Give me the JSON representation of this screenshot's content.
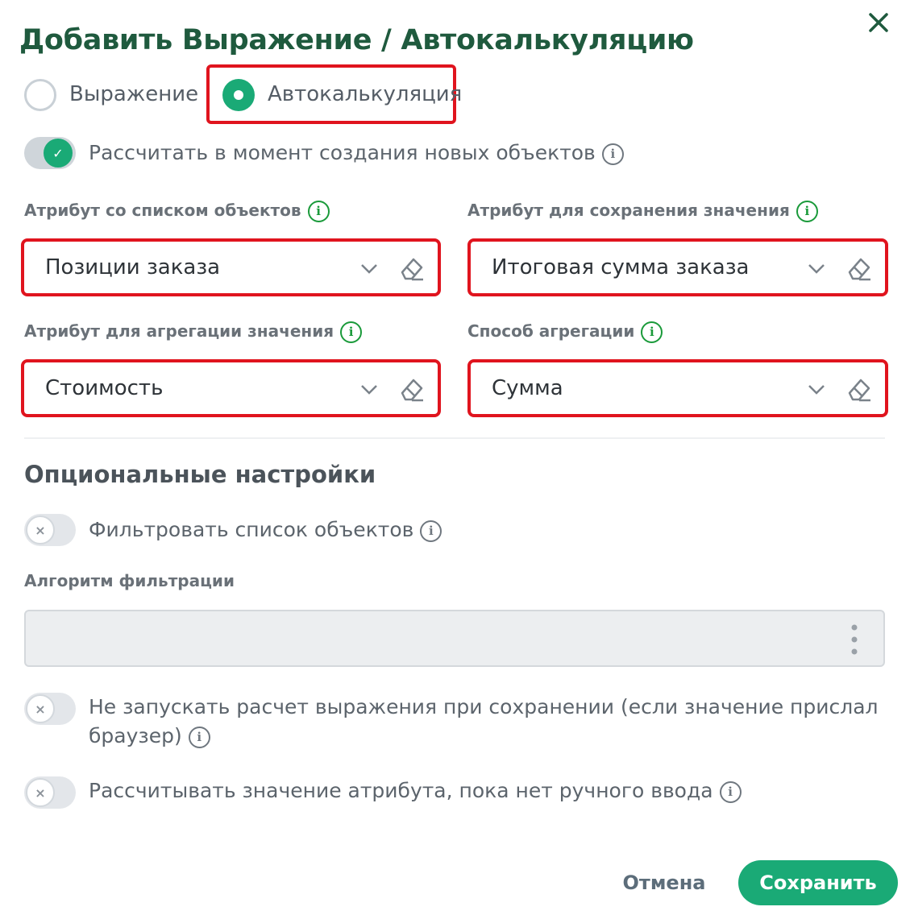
{
  "dialog": {
    "title": "Добавить Выражение / Автокалькуляцию"
  },
  "mode": {
    "options": [
      {
        "label": "Выражение",
        "checked": false
      },
      {
        "label": "Автокалькуляция",
        "checked": true
      }
    ]
  },
  "calc_on_create": {
    "label": "Рассчитать в момент создания новых объектов",
    "enabled": true
  },
  "fields": {
    "list_attribute": {
      "label": "Атрибут со списком объектов",
      "value": "Позиции заказа"
    },
    "save_attribute": {
      "label": "Атрибут для сохранения значения",
      "value": "Итоговая сумма заказа"
    },
    "aggregate_attribute": {
      "label": "Атрибут для агрегации значения",
      "value": "Стоимость"
    },
    "aggregation_method": {
      "label": "Способ агрегации",
      "value": "Сумма"
    }
  },
  "optional": {
    "title": "Опциональные настройки",
    "filter_list": {
      "label": "Фильтровать список объектов",
      "enabled": false
    },
    "filter_algorithm": {
      "label": "Алгоритм фильтрации",
      "value": ""
    },
    "skip_calc_on_save": {
      "label_line1": "Не запускать расчет выражения при сохранении (если значение прислал",
      "label_line2": "браузер)",
      "enabled": false
    },
    "calc_until_manual": {
      "label": "Рассчитывать значение атрибута, пока нет ручного ввода",
      "enabled": false
    }
  },
  "footer": {
    "cancel_label": "Отмена",
    "save_label": "Сохранить"
  },
  "colors": {
    "accent": "#1aaa76",
    "title": "#1f5a3e",
    "highlight": "#e0141e",
    "info_green": "#1a9a3a"
  },
  "icons": {
    "close": "close-icon",
    "info": "info-icon",
    "chevron": "chevron-down-icon",
    "clear": "eraser-icon",
    "menu": "kebab-menu-icon"
  }
}
